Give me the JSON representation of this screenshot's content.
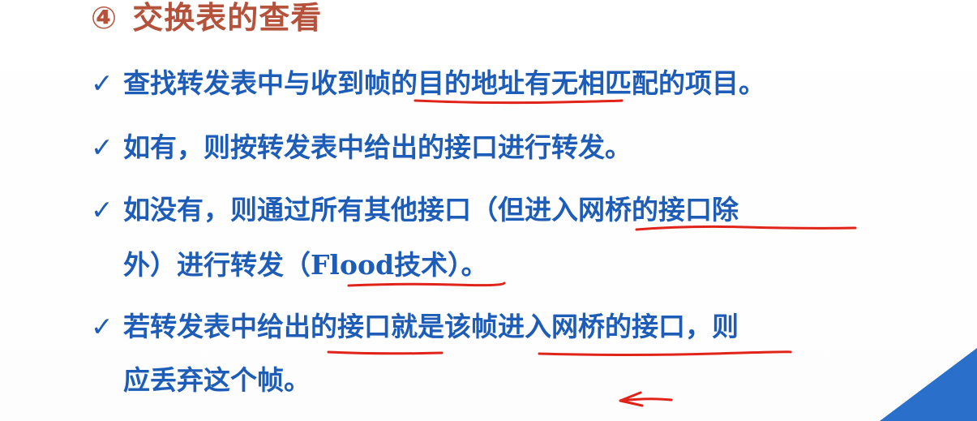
{
  "title": {
    "number": "④",
    "text": "交换表的查看"
  },
  "bullets": [
    {
      "mark": "✓",
      "line1": "查找转发表中与收到帧的目的地址有无相匹配的项目。",
      "line2": ""
    },
    {
      "mark": "✓",
      "line1": "如有，则按转发表中给出的接口进行转发。",
      "line2": ""
    },
    {
      "mark": "✓",
      "line1": "如没有，则通过所有其他接口（但进入网桥的接口除",
      "line2_a": "外）进行转发（",
      "line2_b": "Flood",
      "line2_c": "技术）。"
    },
    {
      "mark": "✓",
      "line1": "若转发表中给出的接口就是该帧进入网桥的接口，则",
      "line2": "应丢弃这个帧。"
    }
  ],
  "colors": {
    "title": "#b5523b",
    "body_text": "#1d5db8",
    "annotation_ink": "#e0241a",
    "corner_accent": "#2a6fc9"
  }
}
